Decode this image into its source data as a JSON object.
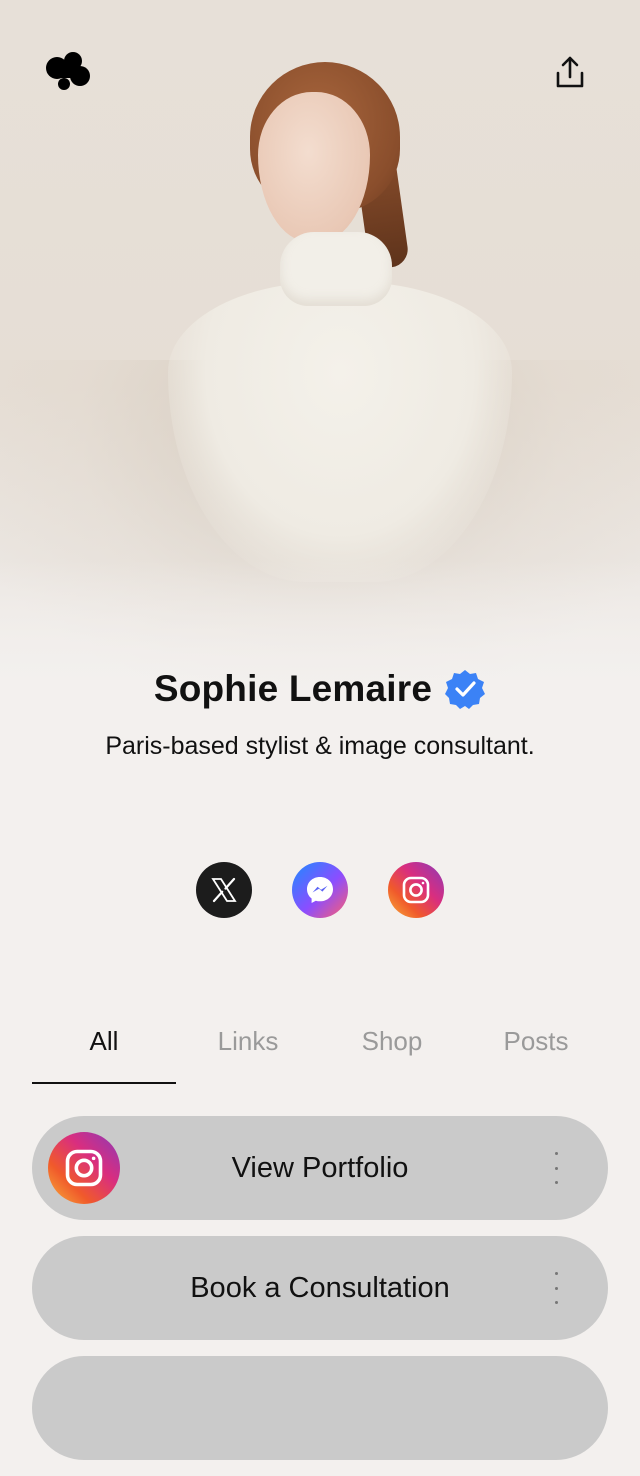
{
  "profile": {
    "name": "Sophie Lemaire",
    "bio": "Paris-based stylist & image consultant.",
    "verified": true
  },
  "header": {
    "logo_icon": "blob-logo-icon",
    "share_icon": "share-upload-icon"
  },
  "socials": [
    {
      "icon": "x-logo-icon"
    },
    {
      "icon": "messenger-icon"
    },
    {
      "icon": "instagram-icon"
    }
  ],
  "tabs": [
    {
      "label": "All",
      "active": true
    },
    {
      "label": "Links",
      "active": false
    },
    {
      "label": "Shop",
      "active": false
    },
    {
      "label": "Posts",
      "active": false
    }
  ],
  "links": [
    {
      "label": "View Portfolio",
      "icon": "instagram-icon"
    },
    {
      "label": "Book a Consultation",
      "icon": ""
    },
    {
      "label": "",
      "icon": ""
    }
  ],
  "colors": {
    "background": "#f3f0ee",
    "link_bg": "#cacaca",
    "verified_badge": "#3b82f6",
    "tab_inactive": "#9a9a9a"
  }
}
